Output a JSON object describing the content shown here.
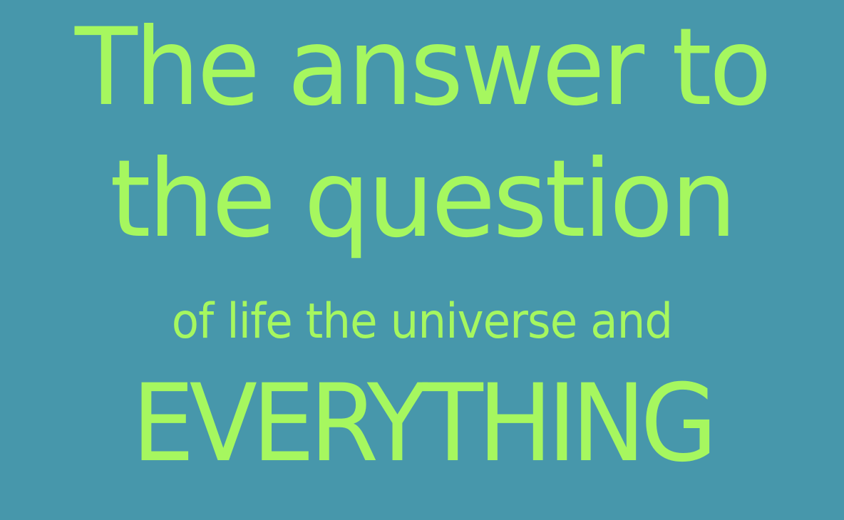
{
  "poster": {
    "line1": "The answer to",
    "line2": "the question",
    "line3": "of life the universe and",
    "line4": "EVERYTHING"
  },
  "colors": {
    "background": "#4797ab",
    "text": "#a6f75f"
  }
}
